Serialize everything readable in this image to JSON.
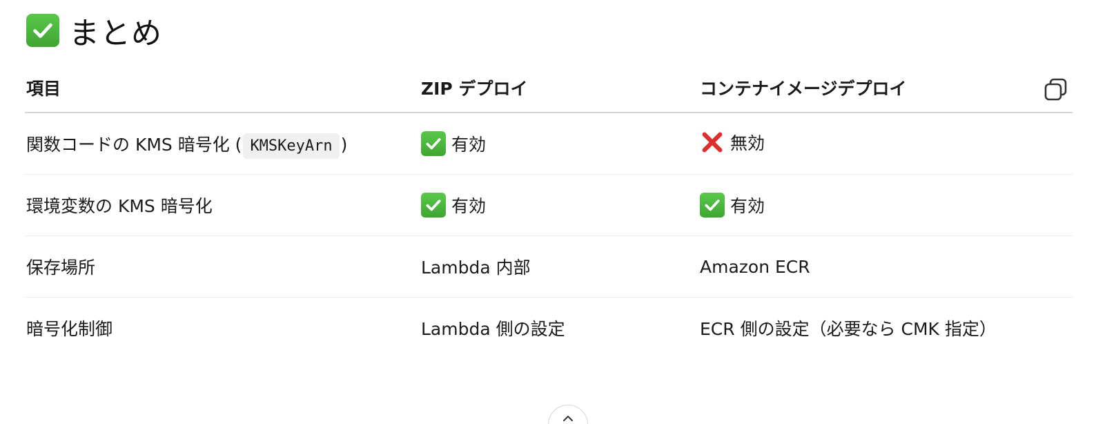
{
  "heading": {
    "icon": "check-mark-button-icon",
    "title": "まとめ"
  },
  "table": {
    "headers": [
      "項目",
      "ZIP デプロイ",
      "コンテナイメージデプロイ"
    ],
    "copy_icon": "copy-icon",
    "rows": [
      {
        "item_prefix": "関数コードの KMS 暗号化 (",
        "item_code": "KMSKeyArn",
        "item_suffix": ")",
        "zip": {
          "icon": "check-icon",
          "text": "有効"
        },
        "container": {
          "icon": "cross-icon",
          "text": "無効"
        }
      },
      {
        "item": "環境変数の KMS 暗号化",
        "zip": {
          "icon": "check-icon",
          "text": "有効"
        },
        "container": {
          "icon": "check-icon",
          "text": "有効"
        }
      },
      {
        "item": "保存場所",
        "zip": "Lambda 内部",
        "container": "Amazon ECR"
      },
      {
        "item": "暗号化制御",
        "zip": "Lambda 側の設定",
        "container": "ECR 側の設定（必要なら CMK 指定）"
      }
    ]
  },
  "colors": {
    "check_green": "#45ad37",
    "cross_red": "#dd2e2e",
    "border": "#d4d4d4",
    "code_bg": "#f0f0f0"
  }
}
